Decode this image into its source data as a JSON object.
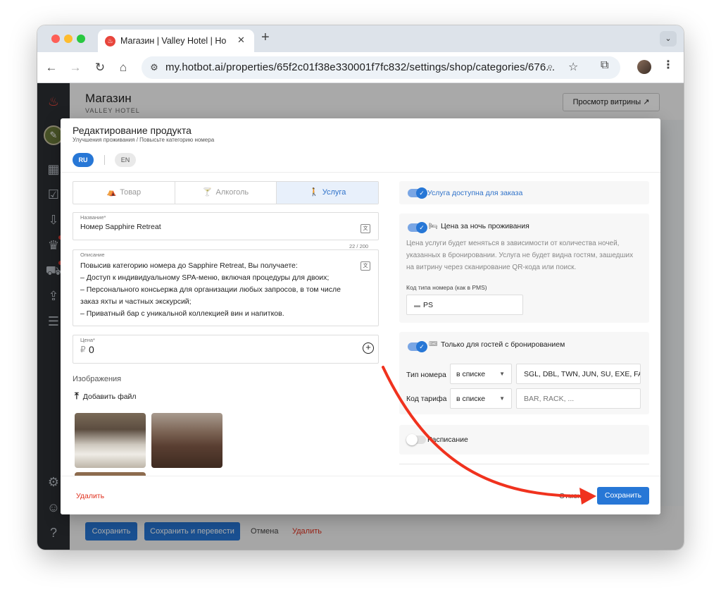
{
  "browser": {
    "tab_title": "Магазин | Valley Hotel | Hotbot",
    "tab_favicon": "flame-icon",
    "url": "my.hotbot.ai/properties/65f2c01f38e330001f7fc832/settings/shop/categories/676...",
    "new_tab": "+",
    "tab_menu": "⌄"
  },
  "app": {
    "title": "Магазин",
    "subtitle": "VALLEY HOTEL",
    "showcase_button": "Просмотр витрины ↗",
    "bottom_buttons": {
      "save": "Сохранить",
      "save_translate": "Сохранить и перевести",
      "cancel": "Отмена",
      "delete": "Удалить"
    },
    "sidebar_icons": [
      "flame-icon",
      "logo-icon",
      "chart-icon",
      "check-icon",
      "inbox-icon",
      "crown-icon",
      "cart-icon",
      "upload-icon",
      "chat-icon",
      "gear-icon",
      "user-icon",
      "help-icon"
    ]
  },
  "modal": {
    "title": "Редактирование продукта",
    "breadcrumb": "Улучшения проживания / Повысьте категорию номера",
    "languages": {
      "ru": "RU",
      "en": "EN",
      "active": "RU"
    },
    "type_tabs": [
      {
        "label": "Товар",
        "icon": "shop-icon",
        "active": false
      },
      {
        "label": "Алкоголь",
        "icon": "cocktail-icon",
        "active": false
      },
      {
        "label": "Услуга",
        "icon": "bellhop-icon",
        "active": true
      }
    ],
    "name_field": {
      "label": "Название*",
      "value": "Номер Sapphire Retreat",
      "counter": "22 / 200"
    },
    "description_field": {
      "label": "Описание",
      "value": "Повысив категорию номера до Sapphire Retreat, Вы получаете:\n– Доступ к индивидуальному SPA-меню, включая процедуры для двоих;\n– Персонального консьержа для организации любых запросов, в том числе заказ яхты и частных экскурсий;\n– Приватный бар с уникальной коллекцией вин и напитков."
    },
    "price_field": {
      "label": "Цена*",
      "currency": "₽",
      "value": "0"
    },
    "images": {
      "label": "Изображения",
      "add_file": "Добавить файл"
    },
    "right": {
      "service_available": {
        "label": "Услуга доступна для заказа",
        "enabled": true
      },
      "night_price": {
        "label": "Цена за ночь проживания",
        "enabled": true,
        "description": "Цена услуги будет меняться в зависимости от количества ночей, указанных в бронировании. Услуга не будет видна гостям, зашедших на витрину через сканирование QR-кода или поиск.",
        "room_type_code_label": "Код типа номера (как в PMS)",
        "room_type_code_value": "PS"
      },
      "booking_guests_only": {
        "label": "Только для гостей с бронированием",
        "enabled": true,
        "room_type_label": "Тип номера",
        "room_type_operator": "в списке",
        "room_type_values": "SGL, DBL, TWN, JUN, SU, EXE, FA",
        "rate_code_label": "Код тарифа",
        "rate_code_operator": "в списке",
        "rate_code_placeholder": "BAR, RACK, ..."
      },
      "schedule": {
        "label": "Расписание",
        "enabled": false
      }
    },
    "footer": {
      "delete": "Удалить",
      "cancel": "Отмена",
      "save": "Сохранить"
    }
  },
  "colors": {
    "accent": "#2777d6",
    "danger": "#e0301e",
    "annotation_arrow": "#f0321e"
  }
}
